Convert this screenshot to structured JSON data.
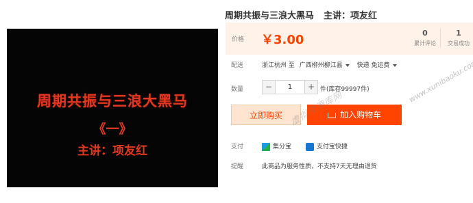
{
  "product": {
    "title": "周期共振与三浪大黑马",
    "teacher": "主讲：项友红"
  },
  "video": {
    "line1": "周期共振与三浪大黑马",
    "line2": "《一》",
    "line3": "主讲：项友红"
  },
  "price": {
    "label": "价格",
    "value": "￥3.00",
    "reviews_count": "0",
    "reviews_label": "累计评论",
    "deals_count": "1",
    "deals_label": "交易成功"
  },
  "shipping": {
    "label": "配送",
    "from": "浙江杭州 至",
    "to": "广西柳州柳江县",
    "method": "快递 免运费"
  },
  "quantity": {
    "label": "数量",
    "value": "1",
    "minus": "−",
    "plus": "+",
    "stock": "件(库存99997件)"
  },
  "buttons": {
    "buy_now": "立即购买",
    "add_cart": "加入购物车"
  },
  "payment": {
    "label": "支付",
    "method1": "集分宝",
    "method2": "支付宝快捷"
  },
  "notice": {
    "label": "提醒",
    "text": "此商品为服务性质，不支持7天无理由退货"
  },
  "watermark": {
    "text": "虚拟资源库网",
    "url": "www.xunibaoku.com"
  },
  "colors": {
    "accent": "#ff4400",
    "price_bg": "#fff2e8"
  }
}
